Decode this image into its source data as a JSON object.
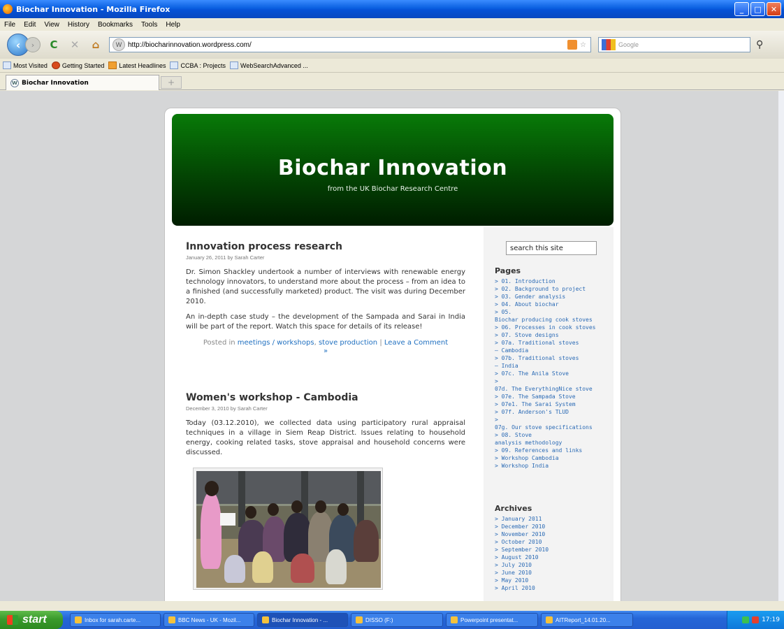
{
  "window": {
    "title": "Biochar Innovation - Mozilla Firefox"
  },
  "menu": [
    "File",
    "Edit",
    "View",
    "History",
    "Bookmarks",
    "Tools",
    "Help"
  ],
  "nav": {
    "url": "http://biocharinnovation.wordpress.com/",
    "search_placeholder": "Google"
  },
  "bookmarks": [
    "Most Visited",
    "Getting Started",
    "Latest Headlines",
    "CCBA : Projects",
    "WebSearchAdvanced ..."
  ],
  "tab": {
    "label": "Biochar Innovation",
    "new_tab": "+"
  },
  "blog": {
    "title": "Biochar Innovation",
    "description": "from the UK Biochar Research Centre"
  },
  "posts": [
    {
      "title": "Innovation process research",
      "meta": "January 26, 2011 by Sarah Carter",
      "paragraphs": [
        "Dr. Simon Shackley undertook a number of interviews with renewable energy technology innovators, to understand more about the process – from an idea to a finished (and successfully marketed) product. The visit was during December 2010.",
        "An in-depth case study – the development of the Sampada and Sarai in India will be part of the report. Watch this space for details of its release!"
      ],
      "posted_in_label": "Posted in",
      "category1": "meetings / workshops",
      "category2": "stove production",
      "separator": "|",
      "comment_link": "Leave a Comment",
      "comment_arrow": "»"
    },
    {
      "title": "Women's workshop - Cambodia",
      "meta": "December 3, 2010 by Sarah Carter",
      "paragraphs": [
        "Today (03.12.2010), we collected data using participatory rural appraisal techniques in a village in Siem Reap District. Issues relating to household energy, cooking related tasks, stove appraisal and household concerns were discussed."
      ]
    }
  ],
  "sidebar": {
    "search_value": "search this site",
    "pages_heading": "Pages",
    "pages": [
      "> 01. Introduction",
      "> 02. Background to project",
      "> 03. Gender analysis",
      "> 04. About biochar",
      "> 05.",
      "Biochar producing cook stoves",
      "> 06. Processes in cook stoves",
      "> 07. Stove designs",
      "  > 07a. Traditional stoves",
      "  – Cambodia",
      "  > 07b. Traditional stoves",
      "  – India",
      "  > 07c. The Anila Stove",
      "  >",
      "  07d. The EverythingNice stove",
      "  > 07e. The Sampada Stove",
      "    > 07e1. The Sarai System",
      "  > 07f. Anderson's TLUD",
      "  >",
      "  07g. Our stove specifications",
      "> 08. Stove",
      "analysis methodology",
      "> 09. References and links",
      "> Workshop Cambodia",
      "> Workshop India"
    ],
    "archives_heading": "Archives",
    "archives": [
      "> January 2011",
      "> December 2010",
      "> November 2010",
      "> October 2010",
      "> September 2010",
      "> August 2010",
      "> July 2010",
      "> June 2010",
      "> May 2010",
      "> April 2010"
    ]
  },
  "taskbar": {
    "start": "start",
    "tasks": [
      "Inbox for sarah.carte...",
      "BBC News - UK - Mozil...",
      "Biochar Innovation - ...",
      "DISSO (F:)",
      "Powerpoint presentat...",
      "AITReport_14.01.20..."
    ],
    "clock": "17:19"
  },
  "colors": {
    "header_green": "#034503",
    "link_blue": "#2070c0",
    "xp_blue": "#245fd0"
  }
}
